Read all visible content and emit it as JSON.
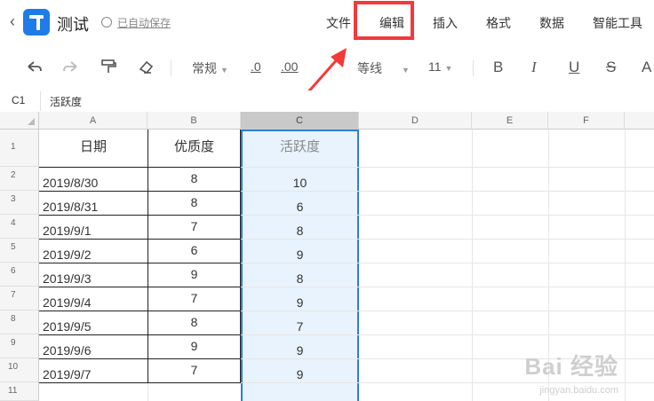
{
  "app": {
    "title": "测试",
    "save_status": "已自动保存",
    "menu": [
      "文件",
      "编辑",
      "插入",
      "格式",
      "数据",
      "智能工具"
    ]
  },
  "toolbar": {
    "format": "常规",
    "decrease_decimal": ".0",
    "increase_decimal": ".00",
    "font": "等线",
    "font_size": "11",
    "bold": "B",
    "italic": "I",
    "underline": "U",
    "strike": "S",
    "font_color": "A"
  },
  "formula_bar": {
    "cell_ref": "C1",
    "content": "活跃度"
  },
  "grid": {
    "columns": [
      "A",
      "B",
      "C",
      "D",
      "E",
      "F"
    ],
    "row_numbers": [
      "1",
      "2",
      "3",
      "4",
      "5",
      "6",
      "7",
      "8",
      "9",
      "10",
      "11"
    ],
    "headers": [
      "日期",
      "优质度",
      "活跃度"
    ],
    "rows": [
      [
        "2019/8/30",
        "8",
        "10"
      ],
      [
        "2019/8/31",
        "8",
        "6"
      ],
      [
        "2019/9/1",
        "7",
        "8"
      ],
      [
        "2019/9/2",
        "6",
        "9"
      ],
      [
        "2019/9/3",
        "9",
        "8"
      ],
      [
        "2019/9/4",
        "7",
        "9"
      ],
      [
        "2019/9/5",
        "8",
        "7"
      ],
      [
        "2019/9/6",
        "9",
        "9"
      ],
      [
        "2019/9/7",
        "7",
        "9"
      ]
    ]
  },
  "watermark": {
    "brand": "Bai 经验",
    "url": "jingyan.baidu.com"
  },
  "colors": {
    "accent": "#2d7fd6",
    "annotation": "#f23a3a",
    "selection_fill": "#e8f3fd"
  }
}
